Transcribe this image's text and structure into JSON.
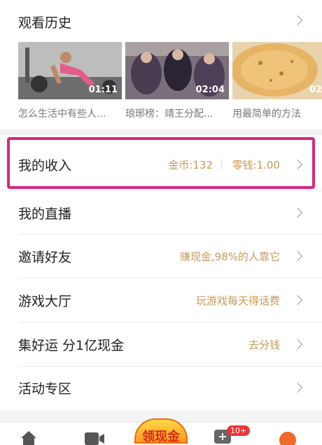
{
  "history": {
    "title": "观看历史",
    "videos": [
      {
        "duration": "01:11",
        "caption": "怎么生活中有些人..."
      },
      {
        "duration": "02:04",
        "caption": "琅琊榜：靖王分配..."
      },
      {
        "duration": "02",
        "caption": "用最简单的方法"
      }
    ]
  },
  "income": {
    "label": "我的收入",
    "coins": "金币:132",
    "change": "零钱:1.00"
  },
  "menu": [
    {
      "label": "我的直播",
      "hint": ""
    },
    {
      "label": "邀请好友",
      "hint": "赚现金,98%的人靠它"
    },
    {
      "label": "游戏大厅",
      "hint": "玩游戏每天得话费"
    },
    {
      "label": "集好运 分1亿现金",
      "hint": "去分钱"
    },
    {
      "label": "活动专区",
      "hint": ""
    }
  ],
  "tabbar": {
    "center_label": "领现金",
    "badge": "10+"
  },
  "colors": {
    "accent": "#c79a55",
    "highlight": "#d6297b"
  }
}
